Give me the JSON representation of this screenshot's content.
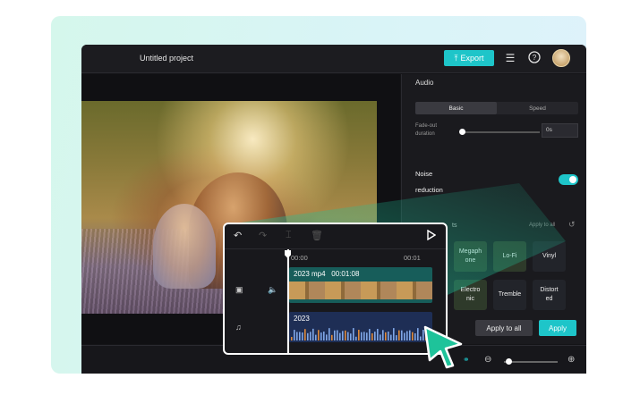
{
  "app": {
    "project_title": "Untitled project",
    "export_label": "Export",
    "export_icon": "upload-icon",
    "toolbar_icons": [
      "layers-icon",
      "help-icon",
      "avatar"
    ]
  },
  "audio_panel": {
    "section_title": "Audio",
    "tabs": [
      {
        "label": "Basic",
        "active": true
      },
      {
        "label": "Speed",
        "active": false
      }
    ],
    "fade_out_label": "Fade-out\nduration",
    "fade_out_value": "0s",
    "noise_label_line1": "Noise",
    "noise_label_line2": "reduction",
    "noise_reduction_on": true,
    "effects_label": "ts",
    "apply_to_all_small": "Apply to all",
    "effects": [
      {
        "label": "Megaph\none"
      },
      {
        "label": "Lo-Fi"
      },
      {
        "label": "Vinyl"
      },
      {
        "label": "Electro\nnic"
      },
      {
        "label": "Tremble"
      },
      {
        "label": "Distort\ned"
      }
    ],
    "apply_to_all_button": "Apply to all",
    "apply_button": "Apply"
  },
  "timeline": {
    "ruler_start": "00:00",
    "ruler_end": "00:01",
    "video_clip_label": "2023 mp4   00:01:08",
    "audio_clip_label": "2023"
  },
  "colors": {
    "accent": "#1ec5c9",
    "app_bg": "#141417",
    "video_clip": "#175d5a",
    "audio_clip": "#1e2e55",
    "backdrop": "#d5f7ec",
    "cursor": "#1ec39a"
  }
}
